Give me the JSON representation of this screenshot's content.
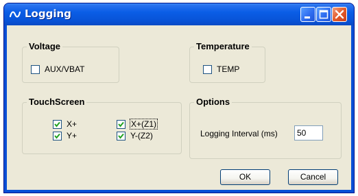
{
  "window": {
    "title": "Logging"
  },
  "groups": {
    "voltage": {
      "title": "Voltage",
      "checkbox": {
        "label": "AUX/VBAT",
        "checked": false
      }
    },
    "temperature": {
      "title": "Temperature",
      "checkbox": {
        "label": "TEMP",
        "checked": false
      }
    },
    "touchscreen": {
      "title": "TouchScreen",
      "checkboxes": [
        {
          "label": "X+",
          "checked": true
        },
        {
          "label": "X+(Z1)",
          "checked": true
        },
        {
          "label": "Y+",
          "checked": true
        },
        {
          "label": "Y-(Z2)",
          "checked": true
        }
      ]
    },
    "options": {
      "title": "Options",
      "interval_label": "Logging Interval (ms)",
      "interval_value": "50"
    }
  },
  "buttons": {
    "ok": "OK",
    "cancel": "Cancel"
  }
}
